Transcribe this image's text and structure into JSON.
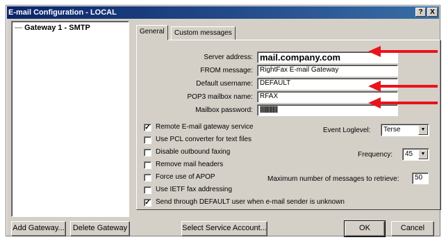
{
  "window": {
    "title": "E-mail Configuration - LOCAL",
    "help_button": "?",
    "close_button": "X"
  },
  "tree": {
    "item": "Gateway 1 - SMTP"
  },
  "tabs": [
    {
      "label": "General"
    },
    {
      "label": "Custom messages"
    }
  ],
  "form": {
    "server_address_label": "Server address:",
    "server_address_value": "mail.company.com",
    "from_message_label": "FROM message:",
    "from_message_value": "RightFax E-mail Gateway",
    "default_username_label": "Default username:",
    "default_username_value": "DEFAULT",
    "pop3_mailbox_label": "POP3 mailbox name:",
    "pop3_mailbox_value": "RFAX",
    "mailbox_password_label": "Mailbox password:",
    "mailbox_password_value": "||||||||||||||"
  },
  "checkboxes": [
    {
      "label": "Remote E-mail gateway service",
      "checked": true,
      "mark": "✓"
    },
    {
      "label": "Use PCL converter for text files",
      "checked": false,
      "mark": ""
    },
    {
      "label": "Disable outbound faxing",
      "checked": false,
      "mark": ""
    },
    {
      "label": "Remove mail headers",
      "checked": false,
      "mark": ""
    },
    {
      "label": "Force use of APOP",
      "checked": false,
      "mark": ""
    },
    {
      "label": "Use IETF fax addressing",
      "checked": false,
      "mark": ""
    },
    {
      "label": "Send through DEFAULT user when e-mail sender is unknown",
      "checked": true,
      "mark": "✓"
    }
  ],
  "event_loglevel": {
    "label": "Event Loglevel:",
    "value": "Terse"
  },
  "frequency": {
    "label": "Frequency:",
    "value": "45"
  },
  "max_messages": {
    "label": "Maximum number of messages to retrieve:",
    "value": "50"
  },
  "buttons": {
    "add_gateway": "Add Gateway...",
    "delete_gateway": "Delete Gateway",
    "select_service_account": "Select Service Account...",
    "ok": "OK",
    "cancel": "Cancel"
  },
  "colors": {
    "titlebar_start": "#0a246a",
    "titlebar_end": "#3a6ea5",
    "dialog_bg": "#d4d0c8",
    "annotation_arrow": "#e8141b"
  },
  "icons": {
    "annotation": "red-arrow-icon",
    "dropdown": "chevron-down-icon"
  }
}
